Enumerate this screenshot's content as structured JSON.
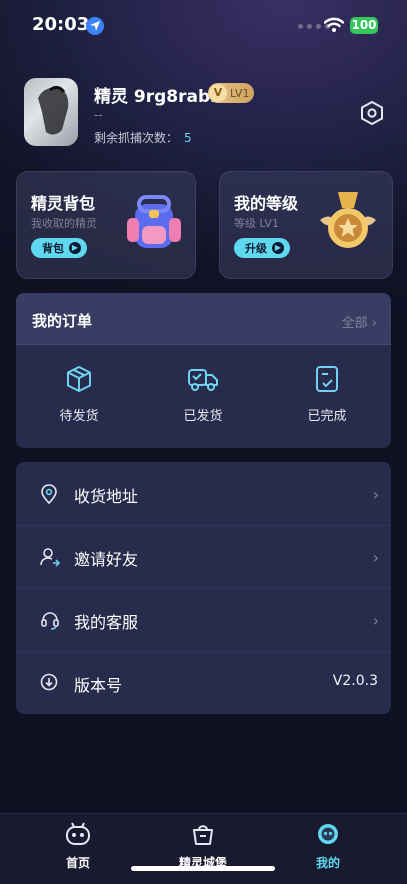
{
  "status_bar": {
    "time": "20:03",
    "battery": "100"
  },
  "profile": {
    "username": "精灵 9rg8rabl",
    "badge_letter": "V",
    "level_badge": "LV1",
    "subtitle": "--",
    "catch_label": "剩余抓捕次数：",
    "catch_count": "5"
  },
  "cards": {
    "backpack": {
      "title": "精灵背包",
      "desc": "我收取的精灵",
      "button": "背包"
    },
    "level": {
      "title": "我的等级",
      "desc": "等级 LV1",
      "button": "升级"
    }
  },
  "orders": {
    "title": "我的订单",
    "all_label": "全部",
    "statuses": [
      {
        "label": "待发货",
        "icon": "package-icon"
      },
      {
        "label": "已发货",
        "icon": "truck-icon"
      },
      {
        "label": "已完成",
        "icon": "checklist-icon"
      }
    ]
  },
  "menu": [
    {
      "label": "收货地址",
      "icon": "location-pin-icon"
    },
    {
      "label": "邀请好友",
      "icon": "invite-user-icon"
    },
    {
      "label": "我的客服",
      "icon": "headset-icon"
    },
    {
      "label": "版本号",
      "icon": "download-circle-icon",
      "value": "V2.0.3"
    }
  ],
  "nav": [
    {
      "label": "首页",
      "icon": "robot-face-icon",
      "active": false
    },
    {
      "label": "精灵城堡",
      "icon": "shopping-bag-icon",
      "active": false
    },
    {
      "label": "我的",
      "icon": "profile-face-icon",
      "active": true
    }
  ],
  "colors": {
    "accent": "#5fd8f0",
    "background": "#121327",
    "card": "#2c3054",
    "battery": "#35c759"
  }
}
